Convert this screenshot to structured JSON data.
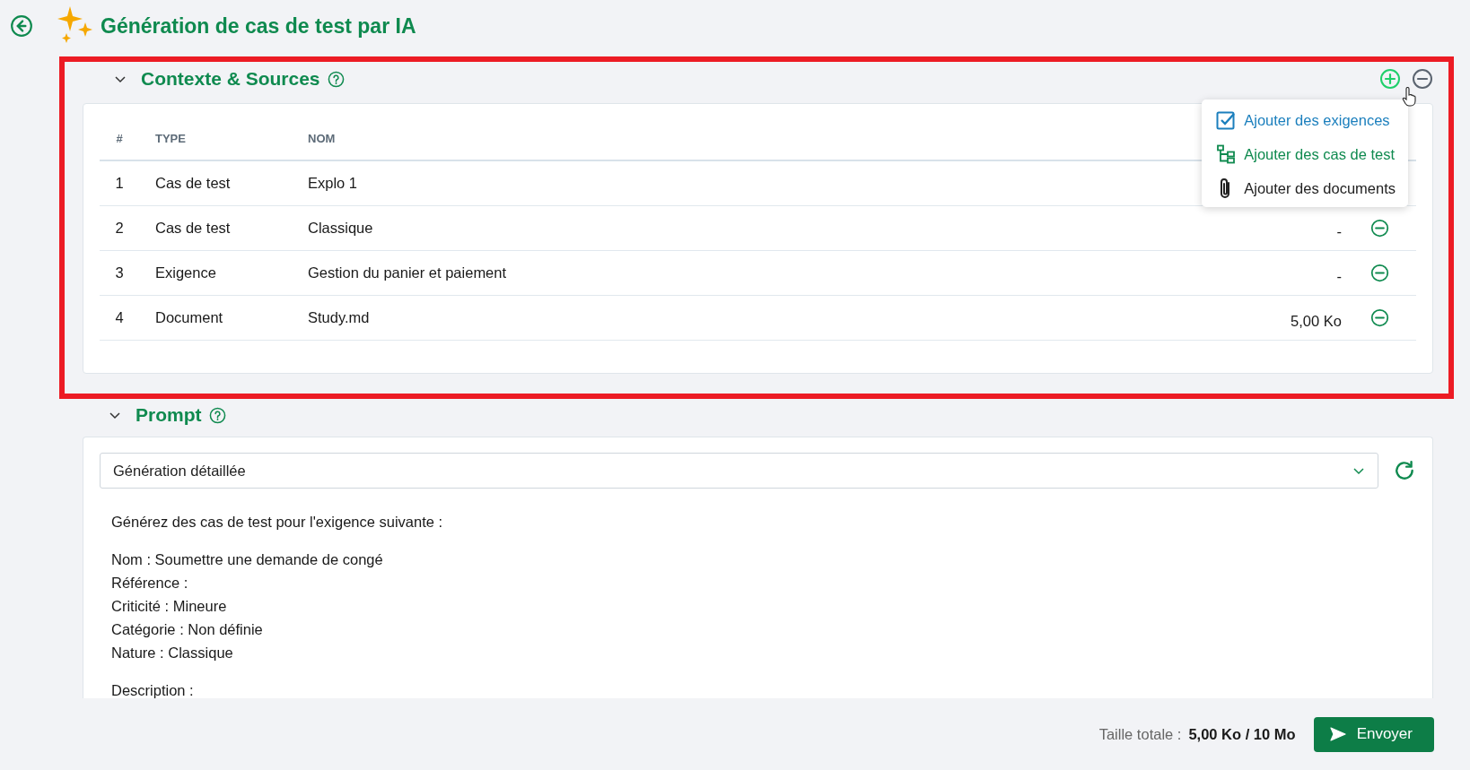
{
  "page": {
    "title": "Génération de cas de test par IA"
  },
  "context": {
    "title": "Contexte & Sources",
    "expanded": true,
    "highlighted": true,
    "columns": [
      "#",
      "TYPE",
      "NOM"
    ],
    "rows": [
      {
        "index": "1",
        "type": "Cas de test",
        "name": "Explo 1"
      },
      {
        "index": "2",
        "type": "Cas de test",
        "name": "Classique",
        "size": "-"
      },
      {
        "index": "3",
        "type": "Exigence",
        "name": "Gestion du panier et paiement",
        "size": "-"
      },
      {
        "index": "4",
        "type": "Document",
        "name": "Study.md",
        "size": "5,00 Ko"
      }
    ],
    "add_menu": [
      {
        "kind": "requirements",
        "label": "Ajouter des exigences",
        "color": "#1b7fbd"
      },
      {
        "kind": "testcases",
        "label": "Ajouter des cas de test",
        "color": "#0f8a4f"
      },
      {
        "kind": "documents",
        "label": "Ajouter des documents",
        "color": "#222222"
      }
    ]
  },
  "prompt": {
    "title": "Prompt",
    "expanded": true,
    "template": "Génération détaillée",
    "paragraphs": [
      [
        "Générez des cas de test pour l'exigence suivante :"
      ],
      [
        "Nom : Soumettre une demande de congé",
        "Référence :",
        "Criticité : Mineure",
        "Catégorie : Non définie",
        "Nature : Classique"
      ],
      [
        "Description :"
      ]
    ]
  },
  "footer": {
    "size_label": "Taille totale :",
    "size_value": "5,00 Ko / 10 Mo",
    "send_button": "Envoyer"
  }
}
